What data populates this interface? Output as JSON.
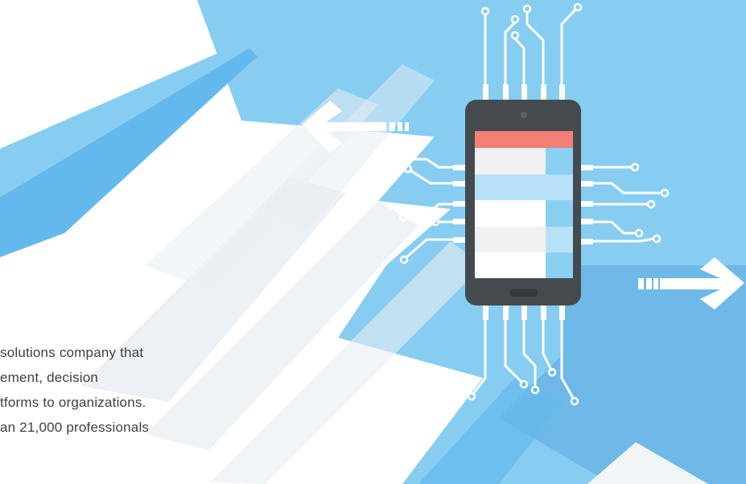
{
  "illustration": {
    "subject": "smartphone-circuit-chip-icon",
    "colors": {
      "background": "#ffffff",
      "sky_blue": "#87cdf2",
      "mid_blue": "#64b9ec",
      "shadow_blue": "#5aaae0",
      "pale_stripe": "#e8eef2",
      "phone_body": "#454a4f",
      "screen_header": "#f37f76",
      "screen_light_blue": "#b6e1f7",
      "screen_accent_blue": "#8ad0f2",
      "screen_grey": "#f0f1f2",
      "circuit_line": "#ffffff"
    },
    "arrows": [
      "arrow-left-icon",
      "arrow-right-icon"
    ]
  },
  "text_lines": [
    "solutions company that",
    "ement, decision",
    "tforms to organizations.",
    "an 21,000 professionals"
  ]
}
